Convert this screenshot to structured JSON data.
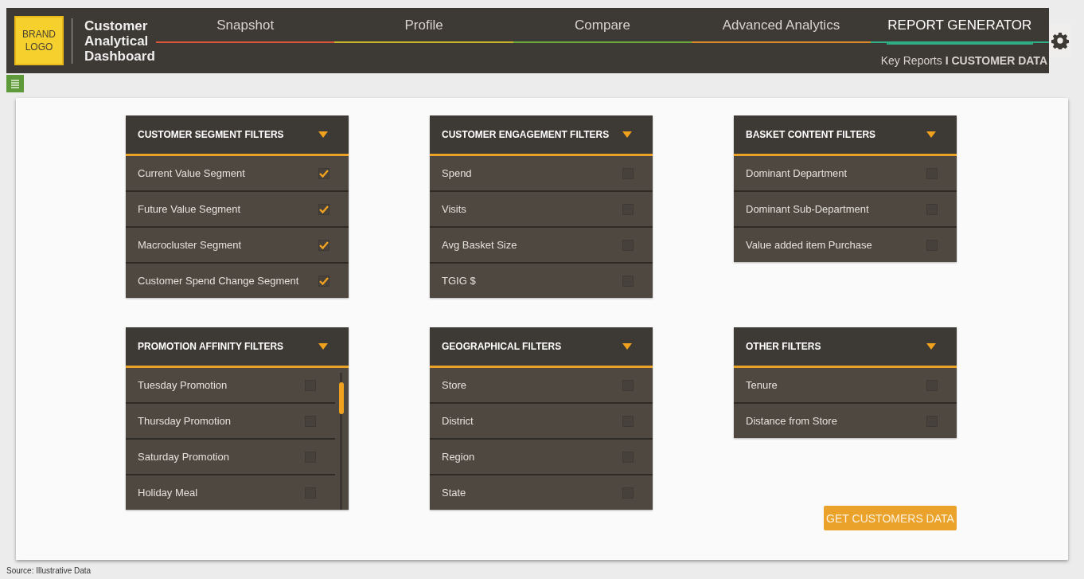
{
  "header": {
    "logo": [
      "BRAND",
      "LOGO"
    ],
    "title": "Customer Analytical Dashboard",
    "tabs": [
      {
        "label": "Snapshot",
        "selected": false,
        "color": "#d9553a"
      },
      {
        "label": "Profile",
        "selected": false,
        "color": "#c9b52a"
      },
      {
        "label": "Compare",
        "selected": false,
        "color": "#6aa83a"
      },
      {
        "label": "Advanced Analytics",
        "selected": false,
        "color": "#d98a2a"
      },
      {
        "label": "REPORT GENERATOR",
        "selected": true,
        "color": "#2fae86"
      }
    ],
    "breadcrumb": "Key Reports **I CUSTOMER DATA**"
  },
  "panels": [
    {
      "title": "CUSTOMER SEGMENT FILTERS",
      "scrollable": false,
      "items": [
        {
          "label": "Current Value Segment",
          "checked": true
        },
        {
          "label": "Future Value Segment",
          "checked": true
        },
        {
          "label": "Macrocluster Segment",
          "checked": true
        },
        {
          "label": "Customer Spend Change Segment",
          "checked": true
        }
      ]
    },
    {
      "title": "CUSTOMER ENGAGEMENT FILTERS",
      "scrollable": false,
      "items": [
        {
          "label": "Spend",
          "checked": false
        },
        {
          "label": "Visits",
          "checked": false
        },
        {
          "label": "Avg Basket Size",
          "checked": false
        },
        {
          "label": "TGIG $",
          "checked": false
        }
      ]
    },
    {
      "title": "BASKET CONTENT FILTERS",
      "scrollable": false,
      "items": [
        {
          "label": "Dominant Department",
          "checked": false
        },
        {
          "label": "Dominant Sub-Department",
          "checked": false
        },
        {
          "label": "Value added item Purchase",
          "checked": false
        }
      ]
    },
    {
      "title": "PROMOTION AFFINITY FILTERS",
      "scrollable": true,
      "items": [
        {
          "label": "Tuesday Promotion",
          "checked": false
        },
        {
          "label": "Thursday Promotion",
          "checked": false
        },
        {
          "label": "Saturday Promotion",
          "checked": false
        },
        {
          "label": "Holiday Meal",
          "checked": false
        }
      ]
    },
    {
      "title": "GEOGRAPHICAL FILTERS",
      "scrollable": false,
      "items": [
        {
          "label": "Store",
          "checked": false
        },
        {
          "label": "District",
          "checked": false
        },
        {
          "label": "Region",
          "checked": false
        },
        {
          "label": "State",
          "checked": false
        }
      ]
    },
    {
      "title": "OTHER FILTERS",
      "scrollable": false,
      "items": [
        {
          "label": "Tenure",
          "checked": false
        },
        {
          "label": "Distance from Store",
          "checked": false
        }
      ]
    }
  ],
  "action_button": "GET CUSTOMERS DATA",
  "source": "Source: Illustrative Data"
}
